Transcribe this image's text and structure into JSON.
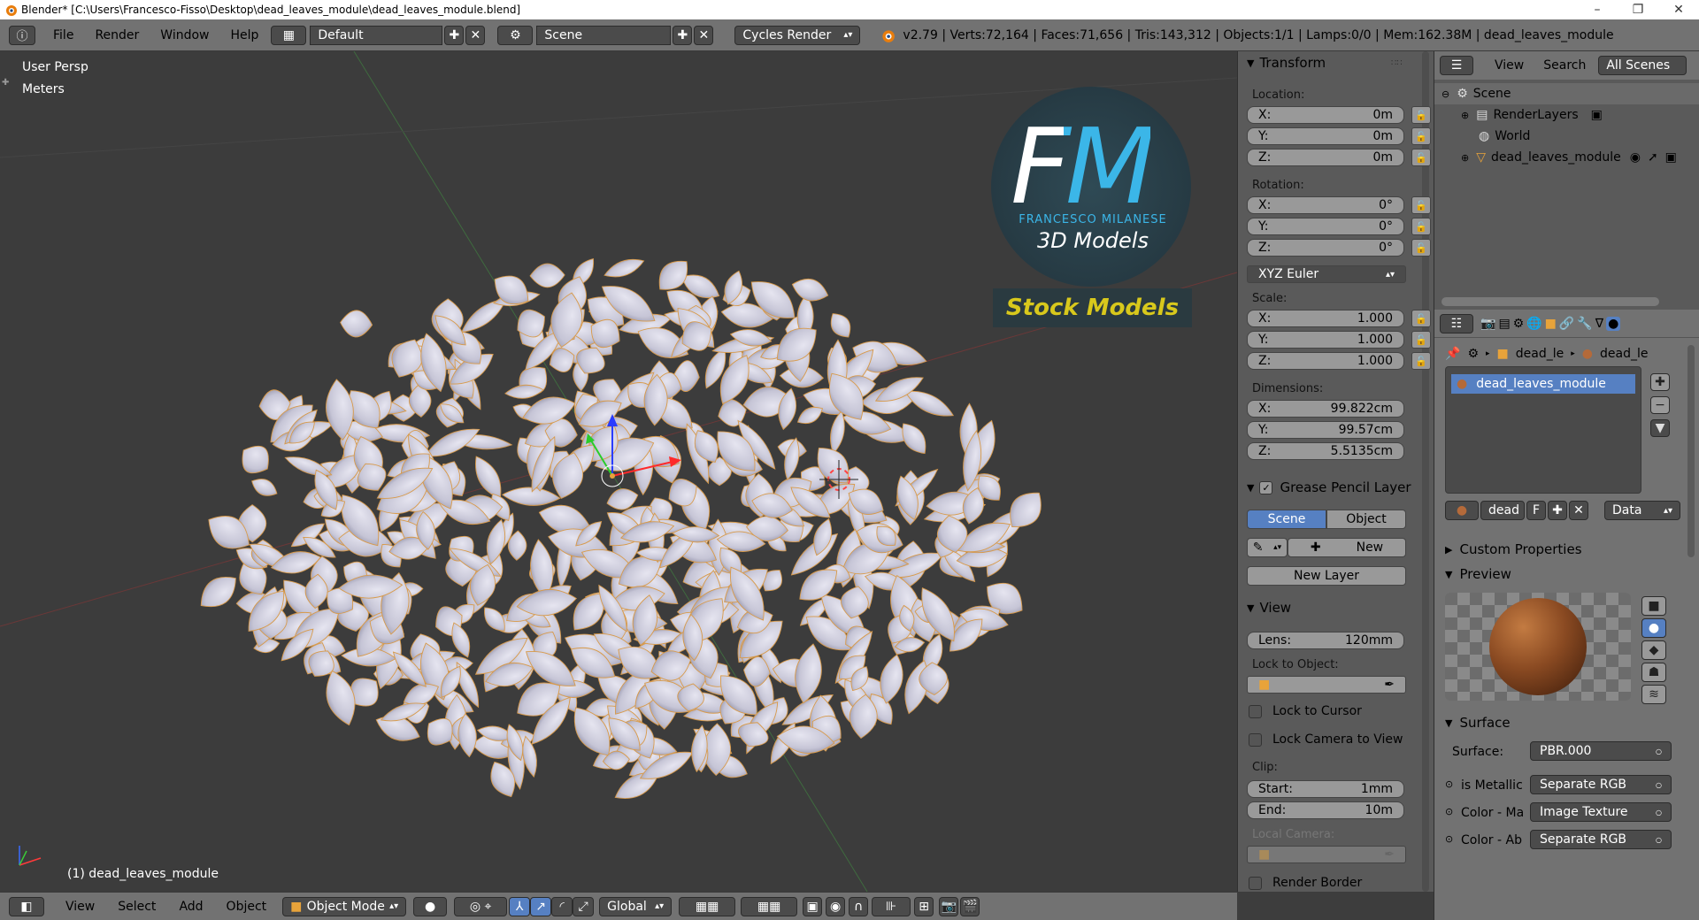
{
  "window": {
    "title": "Blender* [C:\\Users\\Francesco-Fisso\\Desktop\\dead_leaves_module\\dead_leaves_module.blend]",
    "minimize": "–",
    "maximize": "❐",
    "close": "✕"
  },
  "infobar": {
    "menus": [
      "File",
      "Render",
      "Window",
      "Help"
    ],
    "layout": "Default",
    "scene": "Scene",
    "engine": "Cycles Render",
    "stats": "v2.79 | Verts:72,164 | Faces:71,656 | Tris:143,312 | Objects:1/1 | Lamps:0/0 | Mem:162.38M | dead_leaves_module"
  },
  "viewport": {
    "view_name": "User Persp",
    "units": "Meters",
    "object_label": "(1) dead_leaves_module",
    "logo": {
      "letters": "FM",
      "brand": "FRANCESCO MILANESE",
      "sub": "3D Models",
      "banner": "Stock Models"
    }
  },
  "viewport_header": {
    "menus": [
      "View",
      "Select",
      "Add",
      "Object"
    ],
    "mode": "Object Mode",
    "orientation": "Global"
  },
  "npanel": {
    "transform_title": "Transform",
    "location_label": "Location:",
    "location": [
      {
        "axis": "X:",
        "value": "0m"
      },
      {
        "axis": "Y:",
        "value": "0m"
      },
      {
        "axis": "Z:",
        "value": "0m"
      }
    ],
    "rotation_label": "Rotation:",
    "rotation": [
      {
        "axis": "X:",
        "value": "0°"
      },
      {
        "axis": "Y:",
        "value": "0°"
      },
      {
        "axis": "Z:",
        "value": "0°"
      }
    ],
    "rotation_mode": "XYZ Euler",
    "scale_label": "Scale:",
    "scale": [
      {
        "axis": "X:",
        "value": "1.000"
      },
      {
        "axis": "Y:",
        "value": "1.000"
      },
      {
        "axis": "Z:",
        "value": "1.000"
      }
    ],
    "dimensions_label": "Dimensions:",
    "dimensions": [
      {
        "axis": "X:",
        "value": "99.822cm"
      },
      {
        "axis": "Y:",
        "value": "99.57cm"
      },
      {
        "axis": "Z:",
        "value": "5.5135cm"
      }
    ],
    "grease_title": "Grease Pencil Layer",
    "grease_tab_scene": "Scene",
    "grease_tab_object": "Object",
    "grease_new": "New",
    "grease_new_layer": "New Layer",
    "view_title": "View",
    "lens_label": "Lens:",
    "lens_value": "120mm",
    "lock_object_label": "Lock to Object:",
    "lock_cursor": "Lock to Cursor",
    "lock_camera": "Lock Camera to View",
    "clip_label": "Clip:",
    "clip_start_label": "Start:",
    "clip_start": "1mm",
    "clip_end_label": "End:",
    "clip_end": "10m",
    "local_camera": "Local Camera:",
    "render_border": "Render Border"
  },
  "outliner": {
    "menu_view": "View",
    "menu_search": "Search",
    "filter": "All Scenes",
    "rows": [
      {
        "label": "Scene",
        "indent": 0
      },
      {
        "label": "RenderLayers",
        "indent": 1
      },
      {
        "label": "World",
        "indent": 1
      },
      {
        "label": "dead_leaves_module",
        "indent": 1
      }
    ]
  },
  "properties": {
    "breadcrumb_obj": "dead_le",
    "breadcrumb_mat": "dead_le",
    "slot": "dead_leaves_module",
    "mat_name": "dead",
    "mat_f": "F",
    "data_select": "Data",
    "custom_props": "Custom Properties",
    "preview": "Preview",
    "surface_title": "Surface",
    "surface_label": "Surface:",
    "surface_value": "PBR.000",
    "inputs": [
      {
        "label": "is Metallic",
        "value": "Separate RGB"
      },
      {
        "label": "Color - Ma",
        "value": "Image Texture"
      },
      {
        "label": "Color - Ab",
        "value": "Separate RGB"
      }
    ]
  },
  "colors": {
    "accent_blue": "#5680c2",
    "viewport_bg": "#3c3c3c",
    "panel_bg": "#5a5a5a",
    "header_bg": "#727272",
    "leaf_color": "#c9c8d8",
    "logo_cyan": "#3bb6e8",
    "banner_yellow": "#d8c81c"
  }
}
